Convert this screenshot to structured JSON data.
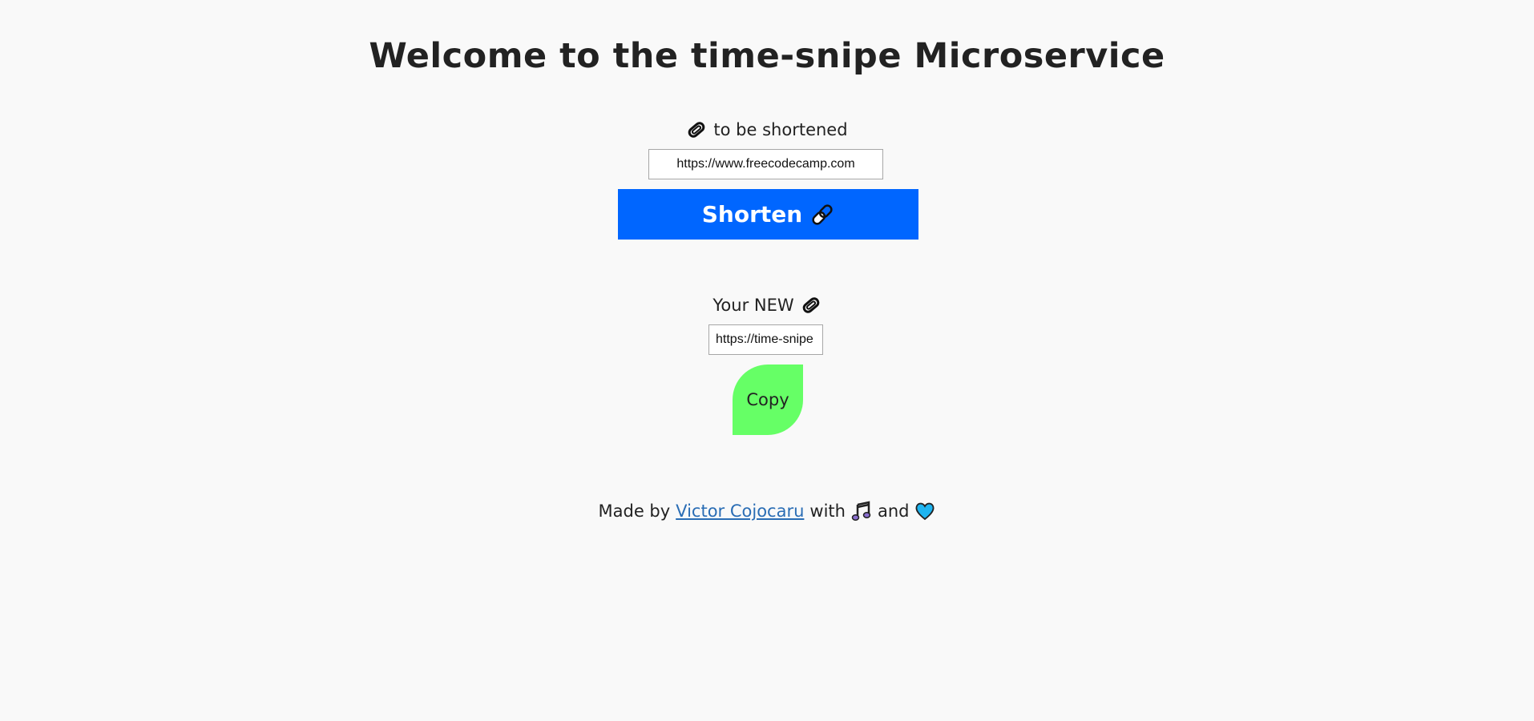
{
  "page": {
    "title": "Welcome to the time-snipe Microservice"
  },
  "shorten": {
    "label": "to be shortened",
    "label_icon": "paperclip-icon",
    "input_value": "https://www.freecodecamp.com",
    "button_label": "Shorten",
    "button_icon": "paperclips-icon",
    "button_color": "#0066ff"
  },
  "result": {
    "label": "Your NEW",
    "label_icon": "paperclip-icon",
    "input_value": "https://time-snipe",
    "copy_label": "Copy",
    "copy_color": "#66ff66"
  },
  "footer": {
    "made_by": "Made by",
    "author": "Victor Cojocaru",
    "with": "with",
    "music_icon": "music-notes-icon",
    "and": "and",
    "heart_icon": "blue-heart-icon",
    "link_color": "#2a6db5"
  },
  "colors": {
    "background": "#f9f9f9",
    "text": "#222222"
  }
}
